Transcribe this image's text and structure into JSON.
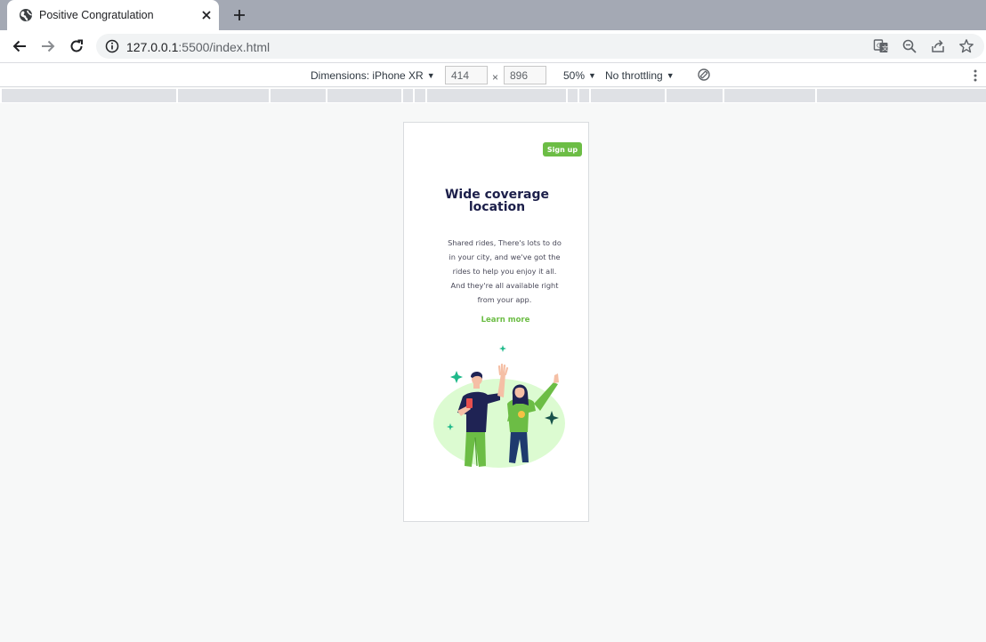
{
  "browser": {
    "tab": {
      "title": "Positive Congratulation",
      "favicon": "globe-icon"
    },
    "url": {
      "host": "127.0.0.1",
      "rest": ":5500/index.html"
    },
    "toolbar_icons": [
      "back-arrow-icon",
      "forward-arrow-icon",
      "reload-icon",
      "info-icon",
      "translate-icon",
      "zoom-icon",
      "share-icon",
      "star-icon"
    ]
  },
  "device_toolbar": {
    "dimensions_label": "Dimensions: iPhone XR",
    "width": "414",
    "height": "896",
    "times": "×",
    "zoom": "50%",
    "throttling": "No throttling"
  },
  "page": {
    "signup_label": "Sign up",
    "headline_line1": "Wide coverage",
    "headline_line2": "location",
    "body_lines": [
      "Shared rides, There's lots to do",
      "in your city, and we've got the",
      "rides to help you enjoy it all.",
      "And they're all available right",
      "from your app."
    ],
    "learn_more": "Learn more",
    "illustration": "people-celebrating-illustration"
  },
  "colors": {
    "accent_green": "#6cbd45",
    "headline_navy": "#1c1f4a",
    "tabstrip": "#a4a9b4"
  }
}
